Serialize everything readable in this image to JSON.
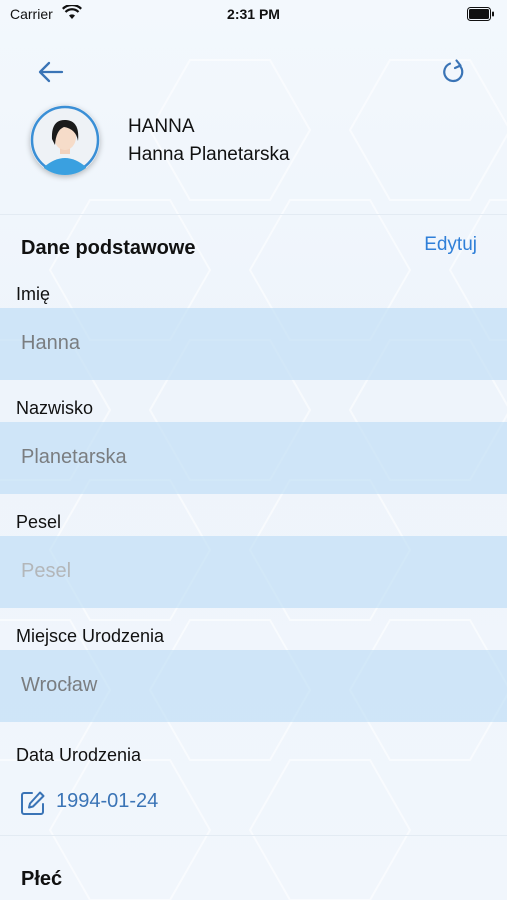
{
  "status_bar": {
    "carrier": "Carrier",
    "time": "2:31 PM"
  },
  "nav": {
    "back_icon": "arrow-left-icon",
    "refresh_icon": "refresh-icon"
  },
  "profile": {
    "nickname": "HANNA",
    "full_name": "Hanna Planetarska",
    "avatar_icon": "female-avatar-icon"
  },
  "basic_section": {
    "title": "Dane podstawowe",
    "edit_label": "Edytuj",
    "fields": {
      "first_name": {
        "label": "Imię",
        "value": "Hanna"
      },
      "last_name": {
        "label": "Nazwisko",
        "value": "Planetarska"
      },
      "pesel": {
        "label": "Pesel",
        "placeholder": "Pesel"
      },
      "birthplace": {
        "label": "Miejsce Urodzenia",
        "value": "Wrocław"
      },
      "birthdate": {
        "label": "Data Urodzenia",
        "value": "1994-01-24",
        "icon": "edit-icon"
      }
    }
  },
  "gender_section": {
    "title": "Płeć"
  },
  "colors": {
    "accent": "#2f7fd8",
    "field_bg": "#bcdcf5",
    "date_text": "#3a74b6"
  }
}
